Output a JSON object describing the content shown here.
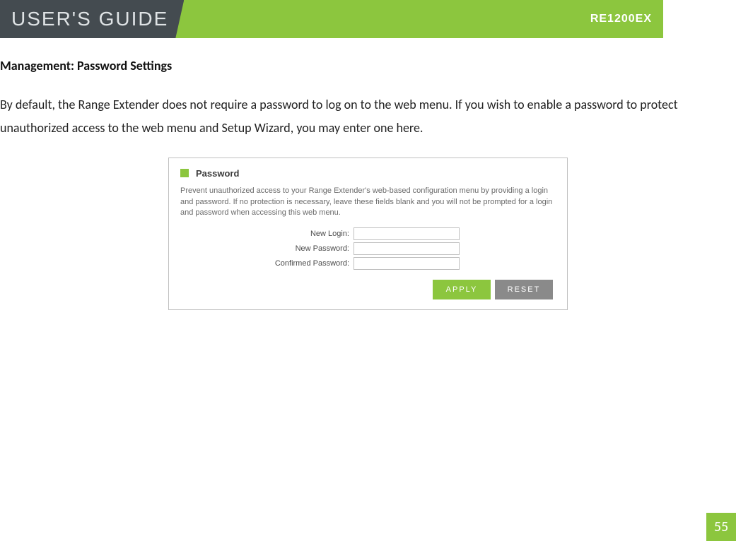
{
  "header": {
    "title": "USER'S GUIDE",
    "model": "RE1200EX"
  },
  "section": {
    "heading": "Management: Password Settings",
    "description": "By default, the Range Extender does not require a password to log on to the web menu. If you wish to enable a password to protect unauthorized access to the web menu and Setup Wizard, you may enter one here."
  },
  "panel": {
    "title": "Password",
    "text": "Prevent unauthorized access to your Range Extender's web-based configuration menu by providing a login and password. If no protection is necessary, leave these fields blank and you will not be prompted for a login and password when accessing this web menu.",
    "fields": {
      "login_label": "New Login:",
      "password_label": "New Password:",
      "confirm_label": "Confirmed Password:",
      "login_value": "",
      "password_value": "",
      "confirm_value": ""
    },
    "buttons": {
      "apply": "APPLY",
      "reset": "RESET"
    }
  },
  "page_number": "55"
}
